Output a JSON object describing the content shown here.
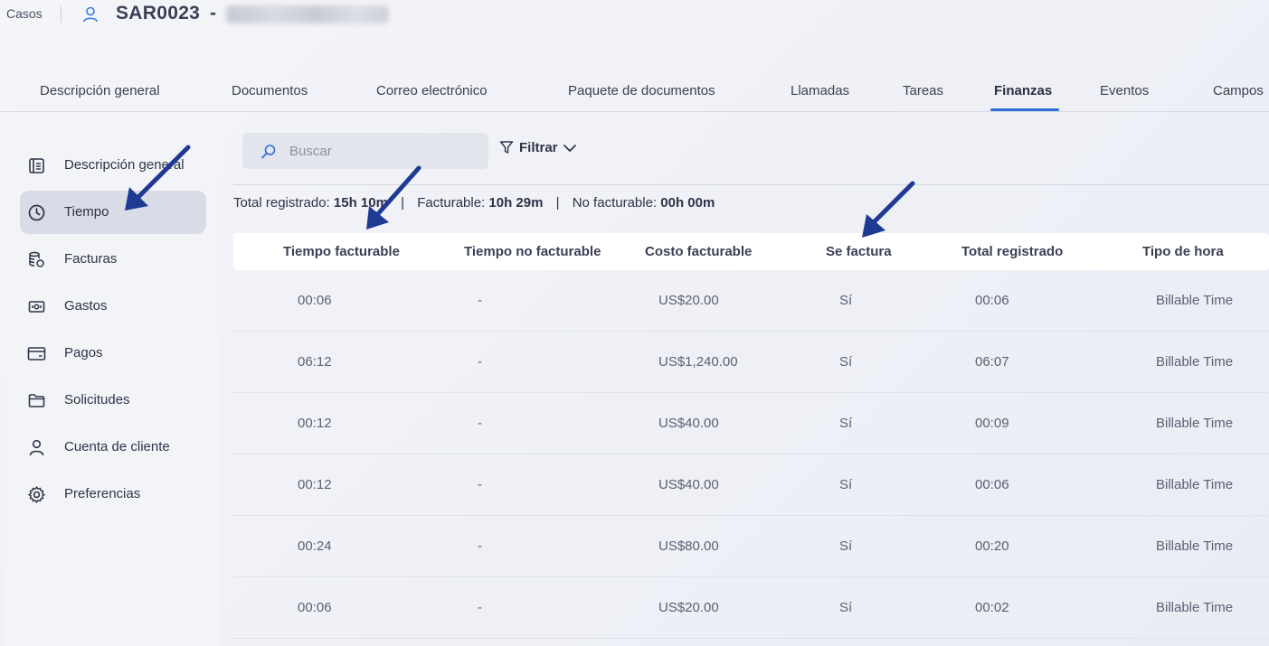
{
  "header": {
    "breadcrumb": "Casos",
    "case_id": "SAR0023",
    "case_dash": "-"
  },
  "tabs": [
    {
      "label": "Descripción general"
    },
    {
      "label": "Documentos"
    },
    {
      "label": "Correo electrónico"
    },
    {
      "label": "Paquete de documentos"
    },
    {
      "label": "Llamadas"
    },
    {
      "label": "Tareas"
    },
    {
      "label": "Finanzas"
    },
    {
      "label": "Eventos"
    },
    {
      "label": "Campos"
    }
  ],
  "active_tab": "Finanzas",
  "sidebar": {
    "items": [
      {
        "label": "Descripción general",
        "icon": "overview-icon"
      },
      {
        "label": "Tiempo",
        "icon": "clock-icon"
      },
      {
        "label": "Facturas",
        "icon": "invoice-icon"
      },
      {
        "label": "Gastos",
        "icon": "expense-icon"
      },
      {
        "label": "Pagos",
        "icon": "card-icon"
      },
      {
        "label": "Solicitudes",
        "icon": "folder-icon"
      },
      {
        "label": "Cuenta de cliente",
        "icon": "user-icon"
      },
      {
        "label": "Preferencias",
        "icon": "gear-icon"
      }
    ],
    "active": "Tiempo"
  },
  "search": {
    "placeholder": "Buscar",
    "value": ""
  },
  "filter": {
    "label": "Filtrar"
  },
  "summary": {
    "total_label": "Total registrado:",
    "total_value": "15h 10m",
    "billable_label": "Facturable:",
    "billable_value": "10h 29m",
    "nonbillable_label": "No facturable:",
    "nonbillable_value": "00h 00m",
    "separator": "|"
  },
  "table": {
    "columns": [
      "Tiempo facturable",
      "Tiempo no facturable",
      "Costo facturable",
      "Se factura",
      "Total registrado",
      "Tipo de hora"
    ],
    "rows": [
      [
        "00:06",
        "-",
        "US$20.00",
        "Sí",
        "00:06",
        "Billable Time"
      ],
      [
        "06:12",
        "-",
        "US$1,240.00",
        "Sí",
        "06:07",
        "Billable Time"
      ],
      [
        "00:12",
        "-",
        "US$40.00",
        "Sí",
        "00:09",
        "Billable Time"
      ],
      [
        "00:12",
        "-",
        "US$40.00",
        "Sí",
        "00:06",
        "Billable Time"
      ],
      [
        "00:24",
        "-",
        "US$80.00",
        "Sí",
        "00:20",
        "Billable Time"
      ],
      [
        "00:06",
        "-",
        "US$20.00",
        "Sí",
        "00:02",
        "Billable Time"
      ]
    ]
  },
  "colors": {
    "accent": "#2f6ddf",
    "annotation_arrow": "#1f3a93",
    "sidebar_active": "#d9dbe6"
  }
}
